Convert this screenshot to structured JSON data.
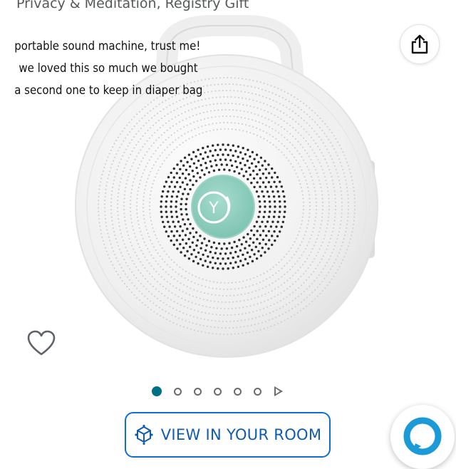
{
  "product": {
    "title": "Privacy & Meditation, Registry Gift",
    "device_logo": "Y"
  },
  "overlay": {
    "lines": [
      "portable sound machine, trust me!",
      "we loved this so much we bought",
      "a second one to keep in diaper bag"
    ]
  },
  "actions": {
    "share_icon": "share-icon",
    "wishlist_icon": "heart-outline-icon",
    "view_in_room_label": "VIEW IN YOUR ROOM",
    "view_in_room_icon": "ar-cube-icon",
    "assistant_icon": "alexa-icon"
  },
  "carousel": {
    "total_dots": 6,
    "active_index": 0,
    "has_video_item": true
  },
  "colors": {
    "accent_teal": "#007185",
    "link_blue": "#0f6fd0",
    "device_white": "#f2f3f3",
    "device_button": "#8fcfbf",
    "alexa_blue": "#1a9bd7"
  }
}
